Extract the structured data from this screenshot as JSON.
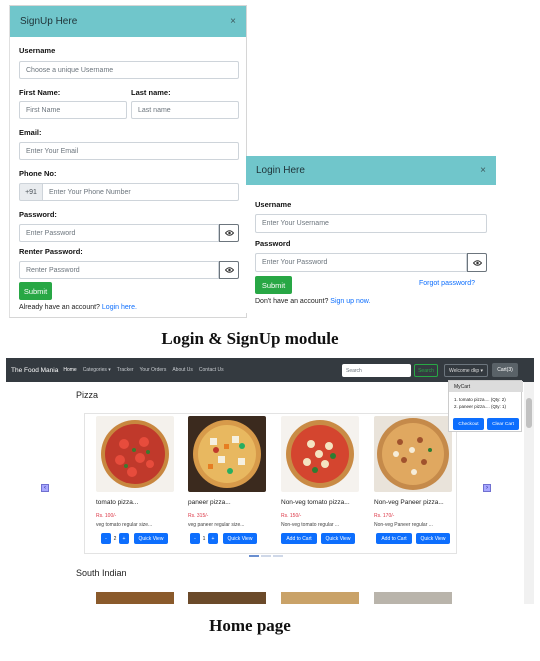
{
  "signup": {
    "title": "SignUp Here",
    "close": "×",
    "username_label": "Username",
    "username_placeholder": "Choose a unique Username",
    "first_name_label": "First Name:",
    "first_name_placeholder": "First Name",
    "last_name_label": "Last name:",
    "last_name_placeholder": "Last name",
    "email_label": "Email:",
    "email_placeholder": "Enter Your Email",
    "phone_label": "Phone No:",
    "phone_prefix": "+91",
    "phone_placeholder": "Enter Your Phone Number",
    "password_label": "Password:",
    "password_placeholder": "Enter Password",
    "renter_label": "Renter Password:",
    "renter_placeholder": "Renter Password",
    "submit": "Submit",
    "footer_text": "Already have an account?",
    "footer_link": "Login here."
  },
  "login": {
    "title": "Login Here",
    "close": "×",
    "username_label": "Username",
    "username_placeholder": "Enter Your Username",
    "password_label": "Password",
    "password_placeholder": "Enter Your Password",
    "submit": "Submit",
    "forgot": "Forgot password?",
    "footer_text": "Don't have an account?",
    "footer_link": "Sign up now."
  },
  "captions": {
    "login_signup": "Login & SignUp module",
    "home": "Home page"
  },
  "home": {
    "navbar": {
      "brand": "The Food Mania",
      "links": [
        "Home",
        "Categories ▾",
        "Tracker",
        "Your Orders",
        "About Us",
        "Contact Us"
      ],
      "search_placeholder": "Search",
      "search_button": "Search",
      "welcome": "Welcome dkp ▾",
      "cart": "Cart(3)"
    },
    "cart_dropdown": {
      "title": "MyCart",
      "items": [
        "1. tomato pizza.... (Qty: 2)",
        "2. paneer pizza.... (Qty: 1)"
      ],
      "checkout": "Checkout",
      "clear": "Clear Cart"
    },
    "sections": [
      "Pizza",
      "South Indian"
    ],
    "cards": [
      {
        "name": "tomato pizza...",
        "price": "Rs. 100/-",
        "desc": "veg tomato regular size...",
        "mode": "qty",
        "qty": "2",
        "quick": "Quick View"
      },
      {
        "name": "paneer pizza...",
        "price": "Rs. 315/-",
        "desc": "veg paneer regular size...",
        "mode": "qty",
        "qty": "1",
        "quick": "Quick View"
      },
      {
        "name": "Non-veg tomato pizza...",
        "price": "Rs. 150/-",
        "desc": "Non-veg tomato regular ...",
        "mode": "add",
        "add": "Add to Cart",
        "quick": "Quick View"
      },
      {
        "name": "Non-veg Paneer pizza...",
        "price": "Rs. 170/-",
        "desc": "Non-veg Paneer regular ...",
        "mode": "add",
        "add": "Add to Cart",
        "quick": "Quick View"
      }
    ],
    "qty_minus": "-",
    "qty_plus": "+",
    "arrow_prev": "‹",
    "arrow_next": "›"
  }
}
